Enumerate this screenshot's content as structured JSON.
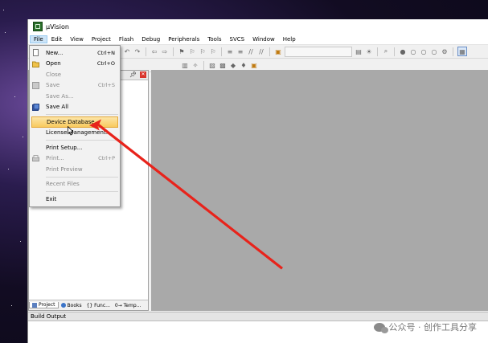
{
  "window": {
    "title": "µVision"
  },
  "menubar": {
    "items": [
      "File",
      "Edit",
      "View",
      "Project",
      "Flash",
      "Debug",
      "Peripherals",
      "Tools",
      "SVCS",
      "Window",
      "Help"
    ]
  },
  "file_menu": {
    "items": [
      {
        "label": "New...",
        "shortcut": "Ctrl+N",
        "icon": "new-file-icon",
        "disabled": false
      },
      {
        "label": "Open",
        "shortcut": "Ctrl+O",
        "icon": "open-folder-icon",
        "disabled": false
      },
      {
        "label": "Close",
        "shortcut": "",
        "icon": "",
        "disabled": true
      },
      {
        "label": "Save",
        "shortcut": "Ctrl+S",
        "icon": "save-icon",
        "disabled": true
      },
      {
        "label": "Save As...",
        "shortcut": "",
        "icon": "",
        "disabled": true
      },
      {
        "label": "Save All",
        "shortcut": "",
        "icon": "save-all-icon",
        "disabled": false
      },
      {
        "label": "Device Database",
        "shortcut": "",
        "icon": "",
        "disabled": false,
        "highlighted": true
      },
      {
        "label": "License Management...",
        "shortcut": "",
        "icon": "",
        "disabled": false
      },
      {
        "label": "Print Setup...",
        "shortcut": "",
        "icon": "",
        "disabled": false
      },
      {
        "label": "Print...",
        "shortcut": "Ctrl+P",
        "icon": "print-icon",
        "disabled": true
      },
      {
        "label": "Print Preview",
        "shortcut": "",
        "icon": "",
        "disabled": true
      },
      {
        "label": "Recent Files",
        "shortcut": "",
        "icon": "",
        "disabled": true
      },
      {
        "label": "Exit",
        "shortcut": "",
        "icon": "",
        "disabled": false
      }
    ]
  },
  "left_panel": {
    "tabs": [
      {
        "label": "Project",
        "icon": "project-icon"
      },
      {
        "label": "Books",
        "icon": "books-icon"
      },
      {
        "label": "{} Func...",
        "icon": ""
      },
      {
        "label": "0→ Temp...",
        "icon": ""
      }
    ]
  },
  "build_output": {
    "title": "Build Output"
  },
  "watermark": {
    "text": "公众号 · 创作工具分享"
  },
  "colors": {
    "highlight": "#f8c95e",
    "arrow": "#e8231b",
    "editor_bg": "#a9a9a9"
  }
}
